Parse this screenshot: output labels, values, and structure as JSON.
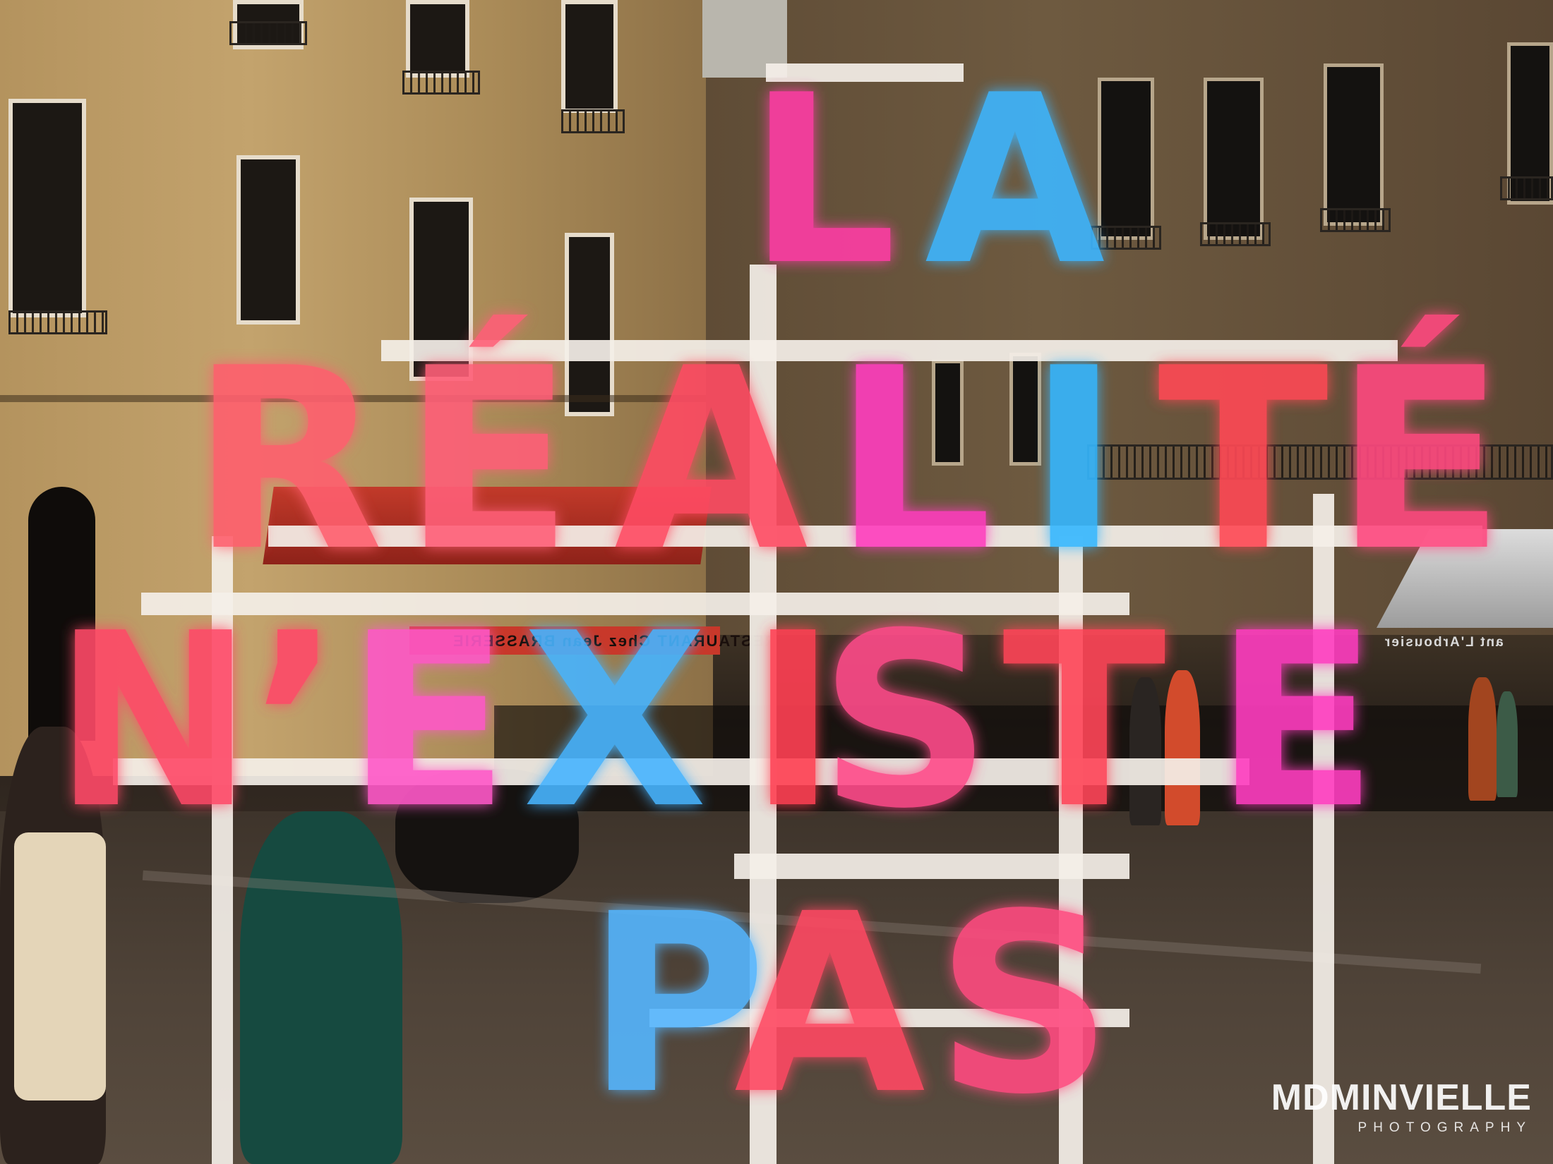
{
  "sign": {
    "line1": [
      {
        "char": "L",
        "color": "#ff3ea5"
      },
      {
        "char": "A",
        "color": "#3cb6ff"
      }
    ],
    "line2": [
      {
        "char": "R",
        "color": "#ff5f6e"
      },
      {
        "char": "É",
        "color": "#ff5f78"
      },
      {
        "char": "A",
        "color": "#ff4c63"
      },
      {
        "char": "L",
        "color": "#ff3ebe"
      },
      {
        "char": "I",
        "color": "#35b7ff"
      },
      {
        "char": "T",
        "color": "#ff4a55"
      },
      {
        "char": "É",
        "color": "#ff4a80"
      }
    ],
    "line3": [
      {
        "char": "N",
        "color": "#ff4a68"
      },
      {
        "char": "’",
        "color": "#ff4a68"
      },
      {
        "char": "E",
        "color": "#ff58c8"
      },
      {
        "char": "X",
        "color": "#46b4ff"
      },
      {
        "char": "I",
        "color": "#ff4052"
      },
      {
        "char": "S",
        "color": "#ff4c8a"
      },
      {
        "char": "T",
        "color": "#ff4458"
      },
      {
        "char": "E",
        "color": "#ff3ec0"
      }
    ],
    "line4": [
      {
        "char": "P",
        "color": "#54b6ff"
      },
      {
        "char": "A",
        "color": "#ff4a63"
      },
      {
        "char": "S",
        "color": "#ff4c80"
      }
    ]
  },
  "reflections": {
    "awning_text": "RESTAURANT Chez Jean BRASSERIE",
    "right_awning_text": "ant L'Arbousier"
  },
  "watermark": {
    "main": "MDMINVIELLE",
    "sub": "PHOTOGRAPHY"
  }
}
